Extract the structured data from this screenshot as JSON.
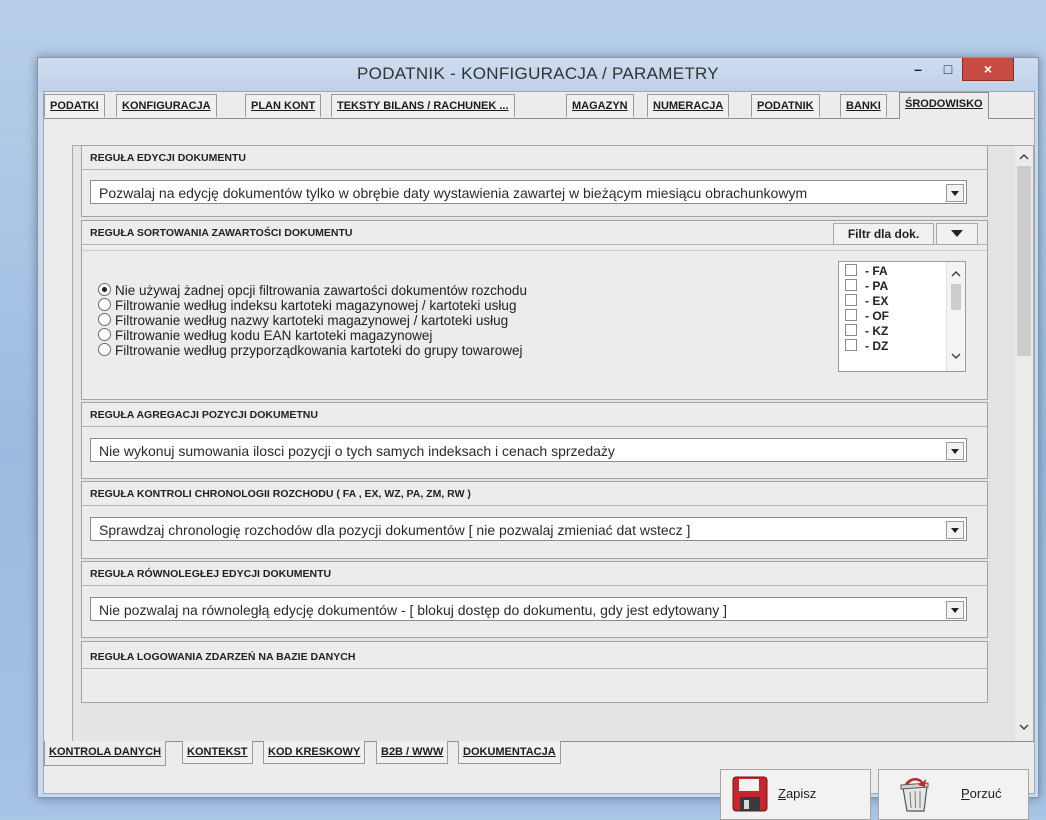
{
  "window": {
    "title": "PODATNIK  - KONFIGURACJA / PARAMETRY",
    "minimize": "–",
    "maximize": "□",
    "close": "×"
  },
  "top_tabs": [
    "PODATKI",
    "KONFIGURACJA",
    "PLAN KONT",
    "TEKSTY BILANS / RACHUNEK ...",
    "MAGAZYN",
    "NUMERACJA",
    "PODATNIK",
    "BANKI",
    "ŚRODOWISKO"
  ],
  "active_top_tab": "ŚRODOWISKO",
  "sections": {
    "edit_rule": {
      "header": "REGUŁA EDYCJI DOKUMENTU",
      "value": "Pozwalaj na edycję dokumentów tylko w obrębie daty wystawienia zawartej w bieżącym miesiącu obrachunkowym"
    },
    "sort_rule": {
      "header": "REGUŁA SORTOWANIA  ZAWARTOŚCI DOKUMENTU",
      "filter_button": "Filtr dla dok.",
      "options": [
        "Nie używaj żadnej opcji filtrowania zawartości dokumentów rozchodu",
        "Filtrowanie według indeksu kartoteki magazynowej / kartoteki usług",
        "Filtrowanie według nazwy kartoteki magazynowej / kartoteki usług",
        "Filtrowanie według kodu EAN kartoteki magazynowej",
        "Filtrowanie według przyporządkowania kartoteki do grupy towarowej"
      ],
      "selected": 0,
      "doc_types": [
        "- FA",
        "- PA",
        "- EX",
        "- OF",
        "- KZ",
        "- DZ"
      ]
    },
    "aggregation_rule": {
      "header": "REGUŁA  AGREGACJI  POZYCJI  DOKUMETNU",
      "value": "Nie wykonuj sumowania ilosci pozycji o tych samych indeksach i cenach sprzedaży"
    },
    "chronology_rule": {
      "header": "REGUŁA KONTROLI  CHRONOLOGII  ROZCHODU  ( FA , EX, WZ, PA, ZM, RW )",
      "value": "Sprawdzaj chronologię rozchodów dla pozycji dokumentów [ nie pozwalaj zmieniać dat wstecz ]"
    },
    "parallel_rule": {
      "header": "REGUŁA  RÓWNOLEGŁEJ  EDYCJI  DOKUMENTU",
      "value": "Nie pozwalaj na równoległą edycję dokumentów -  [ blokuj dostęp do dokumentu, gdy jest edytowany ]"
    },
    "logging_rule": {
      "header": "REGUŁA  LOGOWANIA  ZDARZEŃ  NA  BAZIE  DANYCH"
    }
  },
  "bottom_tabs": [
    "KONTROLA DANYCH",
    "KONTEKST",
    "KOD KRESKOWY",
    "B2B / WWW",
    "DOKUMENTACJA"
  ],
  "active_bottom_tab": "KONTROLA DANYCH",
  "buttons": {
    "save": {
      "mnemonic": "Z",
      "rest": "apisz"
    },
    "discard": {
      "mnemonic": "P",
      "rest": "orzuć"
    }
  },
  "colors": {
    "close_button": "#c74a43",
    "window_frame": "#c9d8ec",
    "panel_bg": "#ececec"
  }
}
